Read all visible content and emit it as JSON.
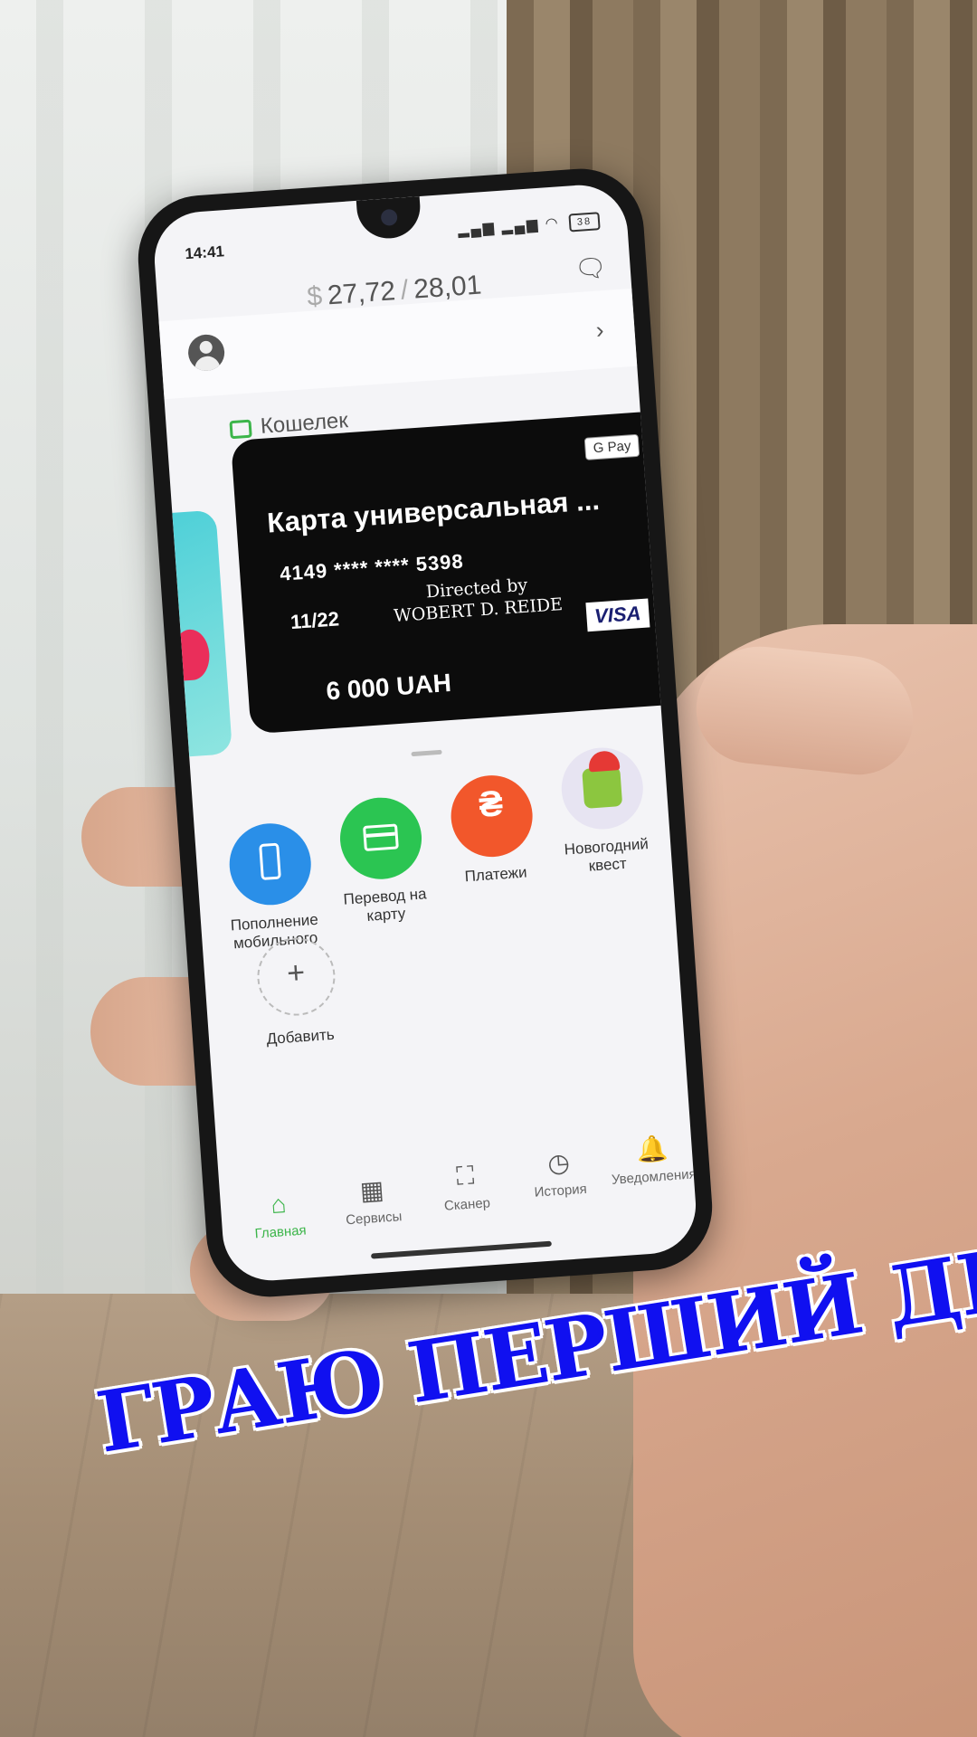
{
  "status": {
    "time": "14:41",
    "battery": "38"
  },
  "rate": {
    "currency_symbol": "$",
    "buy": "27,72",
    "sep": "/",
    "sell": "28,01"
  },
  "wallet": {
    "label": "Кошелек"
  },
  "card": {
    "gpay": "G Pay",
    "title": "Карта универсальная ...",
    "number": "4149 **** **** 5398",
    "expiry": "11/22",
    "holder_line1": "Directed by",
    "holder_line2": "WOBERT D. REIDE",
    "network": "VISA",
    "balance": "6 000 UAH"
  },
  "quick_actions": [
    {
      "label": "Пополнение мобильного",
      "icon": "phone-icon",
      "color": "#2a8fe8"
    },
    {
      "label": "Перевод на карту",
      "icon": "card-icon",
      "color": "#2bc552"
    },
    {
      "label": "Платежи",
      "icon": "hryvnia-icon",
      "glyph": "₴",
      "color": "#f2572b"
    },
    {
      "label": "Новогодний квест",
      "icon": "quest-icon",
      "color": "#e7e4f2"
    }
  ],
  "add": {
    "label": "Добавить",
    "glyph": "+"
  },
  "nav": [
    {
      "label": "Главная",
      "icon": "home-icon",
      "glyph": "⌂"
    },
    {
      "label": "Сервисы",
      "icon": "grid-icon",
      "glyph": "▦"
    },
    {
      "label": "Сканер",
      "icon": "scanner-icon",
      "glyph": "⛶"
    },
    {
      "label": "История",
      "icon": "clock-icon",
      "glyph": "◷"
    },
    {
      "label": "Уведомления",
      "icon": "bell-icon",
      "glyph": "🔔"
    }
  ],
  "caption": "ГРАЮ ПЕРШИЙ ДЕНЬ",
  "colors": {
    "accent_green": "#3cb54a",
    "caption_blue": "#1010f0"
  }
}
